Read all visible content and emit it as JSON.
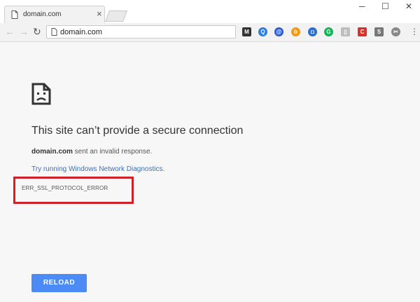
{
  "tab": {
    "title": "domain.com",
    "close": "×"
  },
  "window": {
    "minimize": "─",
    "maximize": "☐",
    "close": "✕"
  },
  "nav": {
    "back": "←",
    "forward": "→",
    "reload": "↻"
  },
  "omnibox": {
    "url": "domain.com"
  },
  "extensions": [
    {
      "name": "m-extension-icon",
      "label": "M",
      "color": "#333333"
    },
    {
      "name": "q-extension-icon",
      "label": "Q",
      "color": "#2a7de1"
    },
    {
      "name": "at-extension-icon",
      "label": "@",
      "color": "#2a5bd7"
    },
    {
      "name": "b-extension-icon",
      "label": "b",
      "color": "#f09a1a"
    },
    {
      "name": "camera-extension-icon",
      "label": "◘",
      "color": "#2a6fd0"
    },
    {
      "name": "grammarly-extension-icon",
      "label": "G",
      "color": "#15b359"
    },
    {
      "name": "clip-extension-icon",
      "label": "▯",
      "color": "#bdbdbd"
    },
    {
      "name": "red-extension-icon",
      "label": "C",
      "color": "#d9312b"
    },
    {
      "name": "s-extension-icon",
      "label": "S",
      "color": "#777777"
    },
    {
      "name": "scissors-extension-icon",
      "label": "✂",
      "color": "#888888"
    }
  ],
  "menu": "⋮",
  "error": {
    "heading": "This site can’t provide a secure connection",
    "domain": "domain.com",
    "message": " sent an invalid response.",
    "link": "Try running Windows Network Diagnostics.",
    "code": "ERR_SSL_PROTOCOL_ERROR",
    "button": "RELOAD"
  },
  "colors": {
    "highlight": "#d0212b",
    "button": "#4c8bf5",
    "link": "#3a6fbf"
  }
}
